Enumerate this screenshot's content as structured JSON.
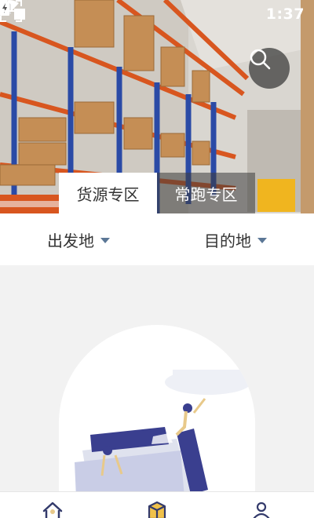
{
  "status_bar": {
    "time": "1:37",
    "icons": [
      "notification-square",
      "wifi-icon",
      "no-sim-icon",
      "battery-charging-icon"
    ]
  },
  "header": {
    "scan_icon": "scan-icon",
    "search_icon": "search-icon"
  },
  "tabs": [
    {
      "label": "货源专区",
      "active": true
    },
    {
      "label": "常跑专区",
      "active": false
    }
  ],
  "filters": {
    "origin": "出发地",
    "destination": "目的地"
  },
  "bottom_nav": {
    "items": [
      {
        "icon": "home-icon"
      },
      {
        "icon": "box-icon"
      },
      {
        "icon": "user-icon"
      }
    ]
  },
  "colors": {
    "accent": "#5b7796",
    "illustration_primary": "#3a3f8f",
    "illustration_secondary": "#e8c98a"
  }
}
